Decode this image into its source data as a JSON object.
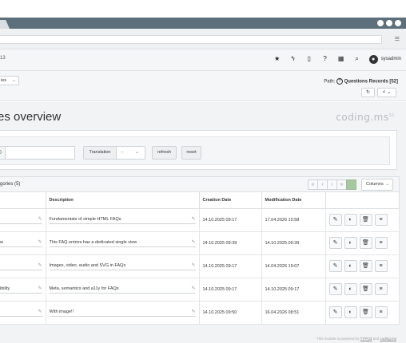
{
  "browser": {
    "menu_icon": "hamburger-icon"
  },
  "toolbar": {
    "breadcrumb": "13",
    "icons": [
      "star-icon",
      "bolt-icon",
      "document-icon",
      "help-icon",
      "grid-icon",
      "search-icon"
    ],
    "user": "sysadmin"
  },
  "docheader": {
    "select_value": "ies",
    "path_label": "Path:",
    "path_value": "Questions Records [52]"
  },
  "page": {
    "title": "es overview",
    "logo": "coding.ms",
    "logo_sup": "31"
  },
  "filter": {
    "search_value": "",
    "search_prefix": ")",
    "translation_label": "Translation",
    "translation_value": "--",
    "refresh_label": "refresh",
    "reset_label": "reset"
  },
  "list": {
    "caption": "gories (5)",
    "pager": [
      "«",
      "‹",
      "›",
      "»"
    ],
    "columns_label": "Columns",
    "headers": [
      "",
      "Description",
      "Creation Date",
      "Modification Date",
      ""
    ],
    "rows": [
      {
        "name": "",
        "description": "Fundamentals of simple HTML FAQs",
        "created": "14.10.2025 09:17",
        "modified": "17.04.2026 10:58"
      },
      {
        "name": "w",
        "description": "This FAQ entries has a dedicated single view",
        "created": "14.10.2025 09:39",
        "modified": "14.10.2025 09:39"
      },
      {
        "name": "",
        "description": "Images, video, audio and SVG in FAQs",
        "created": "14.10.2025 09:17",
        "modified": "14.04.2026 19:07"
      },
      {
        "name": "ibility",
        "description": "Meta, semantics and a11y for FAQs",
        "created": "14.10.2025 09:17",
        "modified": "14.10.2025 09:17"
      },
      {
        "name": "",
        "description": "With image!!",
        "created": "14.10.2025 09:50",
        "modified": "16.04.2026 08:51"
      }
    ]
  },
  "footer": {
    "prefix": "This module is powered by",
    "link1": "TYPO3",
    "and": "and",
    "link2": "coding.ms"
  }
}
